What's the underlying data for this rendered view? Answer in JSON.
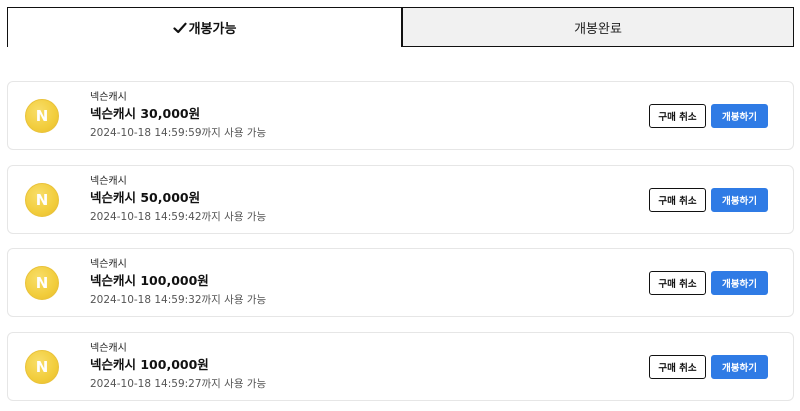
{
  "tabs": [
    {
      "label": "개봉가능",
      "active": true
    },
    {
      "label": "개봉완료",
      "active": false
    }
  ],
  "colors": {
    "accent": "#2f7be5",
    "coin": "#f2cd3c"
  },
  "items": [
    {
      "coin_letter": "N",
      "brand": "넥슨캐시",
      "title": "넥슨캐시 30,000원",
      "expiry": "2024-10-18 14:59:59까지 사용 가능",
      "cancel_label": "구매 취소",
      "open_label": "개봉하기"
    },
    {
      "coin_letter": "N",
      "brand": "넥슨캐시",
      "title": "넥슨캐시 50,000원",
      "expiry": "2024-10-18 14:59:42까지 사용 가능",
      "cancel_label": "구매 취소",
      "open_label": "개봉하기"
    },
    {
      "coin_letter": "N",
      "brand": "넥슨캐시",
      "title": "넥슨캐시 100,000원",
      "expiry": "2024-10-18 14:59:32까지 사용 가능",
      "cancel_label": "구매 취소",
      "open_label": "개봉하기"
    },
    {
      "coin_letter": "N",
      "brand": "넥슨캐시",
      "title": "넥슨캐시 100,000원",
      "expiry": "2024-10-18 14:59:27까지 사용 가능",
      "cancel_label": "구매 취소",
      "open_label": "개봉하기"
    }
  ]
}
